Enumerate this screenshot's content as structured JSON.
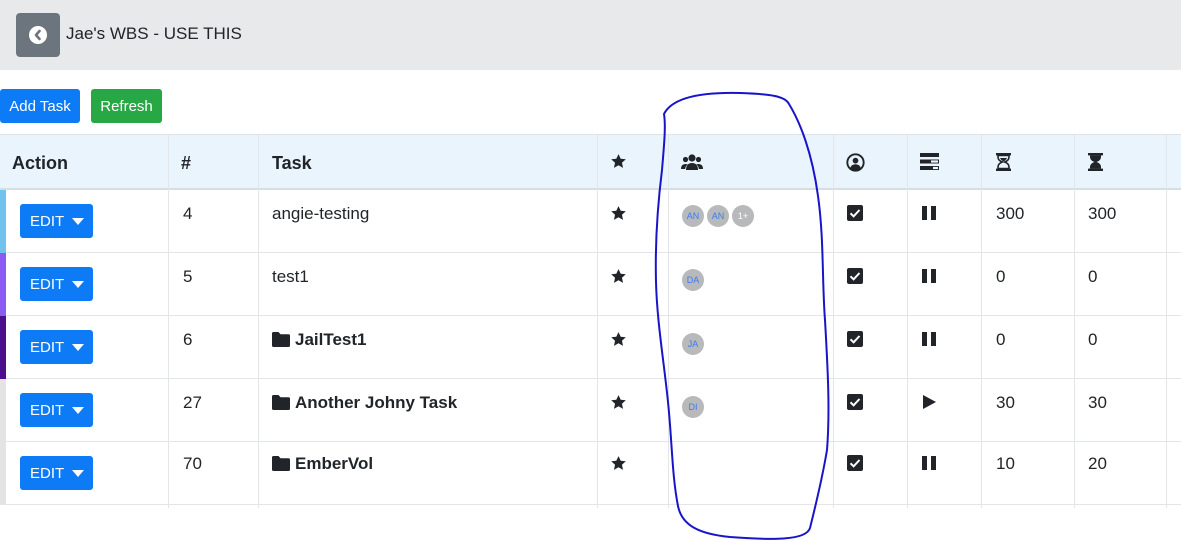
{
  "header": {
    "title": "Jae's WBS - USE THIS"
  },
  "toolbar": {
    "add_label": "Add Task",
    "refresh_label": "Refresh"
  },
  "table": {
    "columns": {
      "action": "Action",
      "number": "#",
      "task": "Task"
    },
    "rows": [
      {
        "num": "4",
        "task": "angie-testing",
        "folder": false,
        "edit": "EDIT",
        "avatars": [
          "AN",
          "AN",
          "1+"
        ],
        "play": false,
        "est": "300",
        "act": "300",
        "stripe": "#6fc3ec"
      },
      {
        "num": "5",
        "task": "test1",
        "folder": false,
        "edit": "EDIT",
        "avatars": [
          "DA"
        ],
        "play": false,
        "est": "0",
        "act": "0",
        "stripe": "#8a5cf0"
      },
      {
        "num": "6",
        "task": "JailTest1",
        "folder": true,
        "edit": "EDIT",
        "avatars": [
          "JA"
        ],
        "play": false,
        "est": "0",
        "act": "0",
        "stripe": "#4b0f8c"
      },
      {
        "num": "27",
        "task": "Another Johny Task",
        "folder": true,
        "edit": "EDIT",
        "avatars": [
          "DI"
        ],
        "play": true,
        "est": "30",
        "act": "30",
        "stripe": "#e4e4e4"
      },
      {
        "num": "70",
        "task": "EmberVol",
        "folder": true,
        "edit": "EDIT",
        "avatars": [],
        "play": false,
        "est": "10",
        "act": "20",
        "stripe": "#e4e4e4"
      }
    ]
  },
  "icons": {
    "back": "chevron-left-icon",
    "star": "star-icon",
    "team": "users-icon",
    "owner": "user-circle-icon",
    "status": "tasks-icon",
    "est": "hourglass-start-icon",
    "act": "hourglass-half-icon",
    "check": "check-square-icon",
    "pause": "pause-icon",
    "play": "play-icon",
    "folder": "folder-icon"
  },
  "colors": {
    "primary": "#0d7bf5",
    "success": "#28a745",
    "annotation": "#1a14c9"
  }
}
